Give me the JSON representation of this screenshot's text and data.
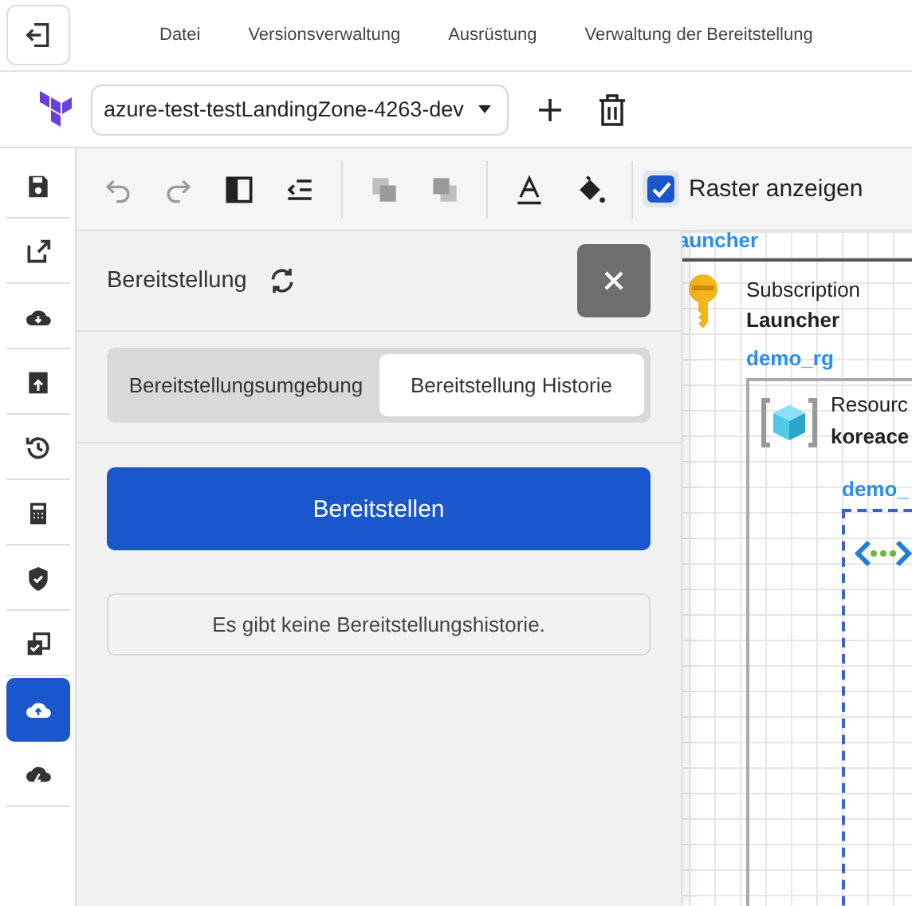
{
  "menu": {
    "items": [
      "Datei",
      "Versionsverwaltung",
      "Ausrüstung",
      "Verwaltung der Bereitstellung"
    ]
  },
  "project": {
    "value": "azure-test-testLandingZone-4263-dev"
  },
  "sidebar": {
    "items": [
      {
        "selected": false
      },
      {
        "selected": false
      },
      {
        "selected": false
      },
      {
        "selected": false
      },
      {
        "selected": false
      },
      {
        "selected": false
      },
      {
        "selected": false
      },
      {
        "selected": false
      },
      {
        "selected": true
      },
      {
        "selected": false
      }
    ]
  },
  "toolbar": {
    "tools": [
      {
        "disabled": true
      },
      {
        "disabled": true
      },
      {
        "disabled": false
      },
      {
        "disabled": false
      },
      {
        "disabled": true
      },
      {
        "disabled": true
      },
      {
        "disabled": false
      },
      {
        "disabled": false
      }
    ],
    "grid_checkbox": {
      "label": "Raster anzeigen",
      "checked": true
    }
  },
  "panel": {
    "title": "Bereitstellung",
    "tabs": [
      {
        "label": "Bereitstellungsumgebung",
        "selected": false
      },
      {
        "label": "Bereitstellung Historie",
        "selected": true
      }
    ],
    "deploy_button": "Bereitstellen",
    "empty_message": "Es gibt keine Bereitstellungshistorie."
  },
  "canvas": {
    "top_label": "auncher",
    "subscription": {
      "type": "Subscription",
      "name": "Launcher"
    },
    "group_label": "demo_rg",
    "resource_group": {
      "type": "Resourc",
      "name": "koreace"
    },
    "inner_label": "demo_"
  }
}
